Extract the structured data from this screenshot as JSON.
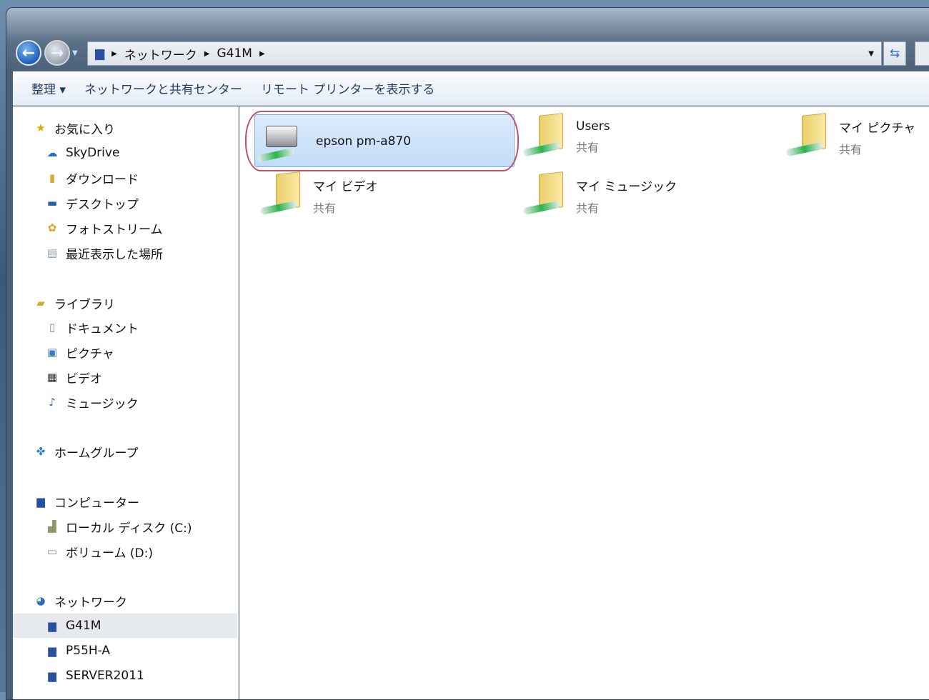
{
  "address": {
    "icon": "network-computer-icon",
    "segments": [
      "ネットワーク",
      "G41M"
    ]
  },
  "toolbar": {
    "organize": "整理 ▾",
    "network_center": "ネットワークと共有センター",
    "remote_printers": "リモート プリンターを表示する"
  },
  "sidebar": {
    "items": [
      {
        "label": "お気に入り",
        "icon": "★",
        "color": "#e8a800",
        "indent": 0
      },
      {
        "label": "SkyDrive",
        "icon": "☁",
        "color": "#1e6fc9",
        "indent": 1
      },
      {
        "label": "ダウンロード",
        "icon": "▮",
        "color": "#d4aa3a",
        "indent": 1
      },
      {
        "label": "デスクトップ",
        "icon": "▬",
        "color": "#2a60b0",
        "indent": 1
      },
      {
        "label": "フォトストリーム",
        "icon": "✿",
        "color": "#e0a020",
        "indent": 1
      },
      {
        "label": "最近表示した場所",
        "icon": "▤",
        "color": "#8a9aab",
        "indent": 1
      },
      {
        "label": "ライブラリ",
        "icon": "▰",
        "color": "#d4aa3a",
        "indent": 0
      },
      {
        "label": "ドキュメント",
        "icon": "▯",
        "color": "#7a8a9a",
        "indent": 1
      },
      {
        "label": "ピクチャ",
        "icon": "▣",
        "color": "#3a7ac0",
        "indent": 1
      },
      {
        "label": "ビデオ",
        "icon": "▦",
        "color": "#333",
        "indent": 1
      },
      {
        "label": "ミュージック",
        "icon": "♪",
        "color": "#2a70c0",
        "indent": 1
      },
      {
        "label": "ホームグループ",
        "icon": "✤",
        "color": "#2a80c0",
        "indent": 0
      },
      {
        "label": "コンピューター",
        "icon": "▆",
        "color": "#2a50a0",
        "indent": 0
      },
      {
        "label": "ローカル ディスク (C:)",
        "icon": "▟",
        "color": "#8a9a6a",
        "indent": 1
      },
      {
        "label": "ボリューム (D:)",
        "icon": "▭",
        "color": "#888",
        "indent": 1
      },
      {
        "label": "ネットワーク",
        "icon": "◕",
        "color": "#2a70b0",
        "indent": 0
      },
      {
        "label": "G41M",
        "icon": "▆",
        "color": "#2a50a0",
        "indent": 1,
        "selected": true
      },
      {
        "label": "P55H-A",
        "icon": "▆",
        "color": "#2a50a0",
        "indent": 1
      },
      {
        "label": "SERVER2011",
        "icon": "▆",
        "color": "#2a50a0",
        "indent": 1
      }
    ]
  },
  "content": {
    "items": [
      {
        "name": "epson pm-a870",
        "type": "printer",
        "sub": "",
        "selected": true
      },
      {
        "name": "Users",
        "type": "folder",
        "sub": "共有"
      },
      {
        "name": "マイ ピクチャ",
        "type": "folder",
        "sub": "共有"
      },
      {
        "name": "マイ ビデオ",
        "type": "folder",
        "sub": "共有"
      },
      {
        "name": "マイ ミュージック",
        "type": "folder",
        "sub": "共有"
      }
    ]
  }
}
